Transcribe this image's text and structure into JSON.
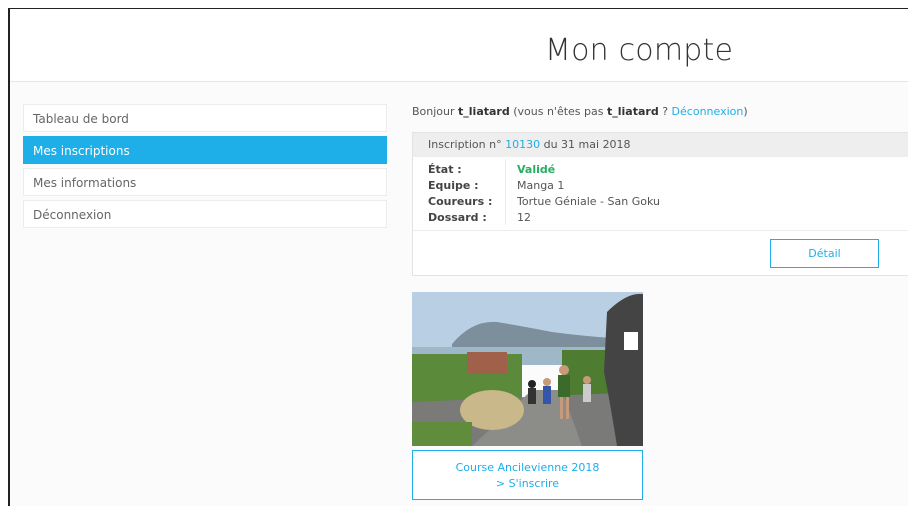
{
  "header": {
    "title": "Mon compte"
  },
  "sidebar": {
    "items": [
      {
        "label": "Tableau de bord"
      },
      {
        "label": "Mes inscriptions"
      },
      {
        "label": "Mes informations"
      },
      {
        "label": "Déconnexion"
      }
    ]
  },
  "greeting": {
    "hello": "Bonjour",
    "username": "t_liatard",
    "not_user_prefix": "(vous n'êtes pas",
    "not_user_name": "t_liatard",
    "question": "?",
    "logout_link": "Déconnexion",
    "close_paren": ")"
  },
  "registration": {
    "header_prefix": "Inscription n°",
    "number": "10130",
    "date_text": "du 31 mai 2018",
    "fields": {
      "status_label": "État :",
      "status_value": "Validé",
      "team_label": "Equipe :",
      "team_value": "Manga 1",
      "runners_label": "Coureurs :",
      "runners_value": "Tortue Géniale - San Goku",
      "bib_label": "Dossard :",
      "bib_value": "12"
    },
    "detail_button": "Détail"
  },
  "race_card": {
    "name": "Course Ancilevienne 2018",
    "action": "> S'inscrire"
  },
  "colors": {
    "accent": "#1eaee8",
    "valid": "#27ae60"
  }
}
